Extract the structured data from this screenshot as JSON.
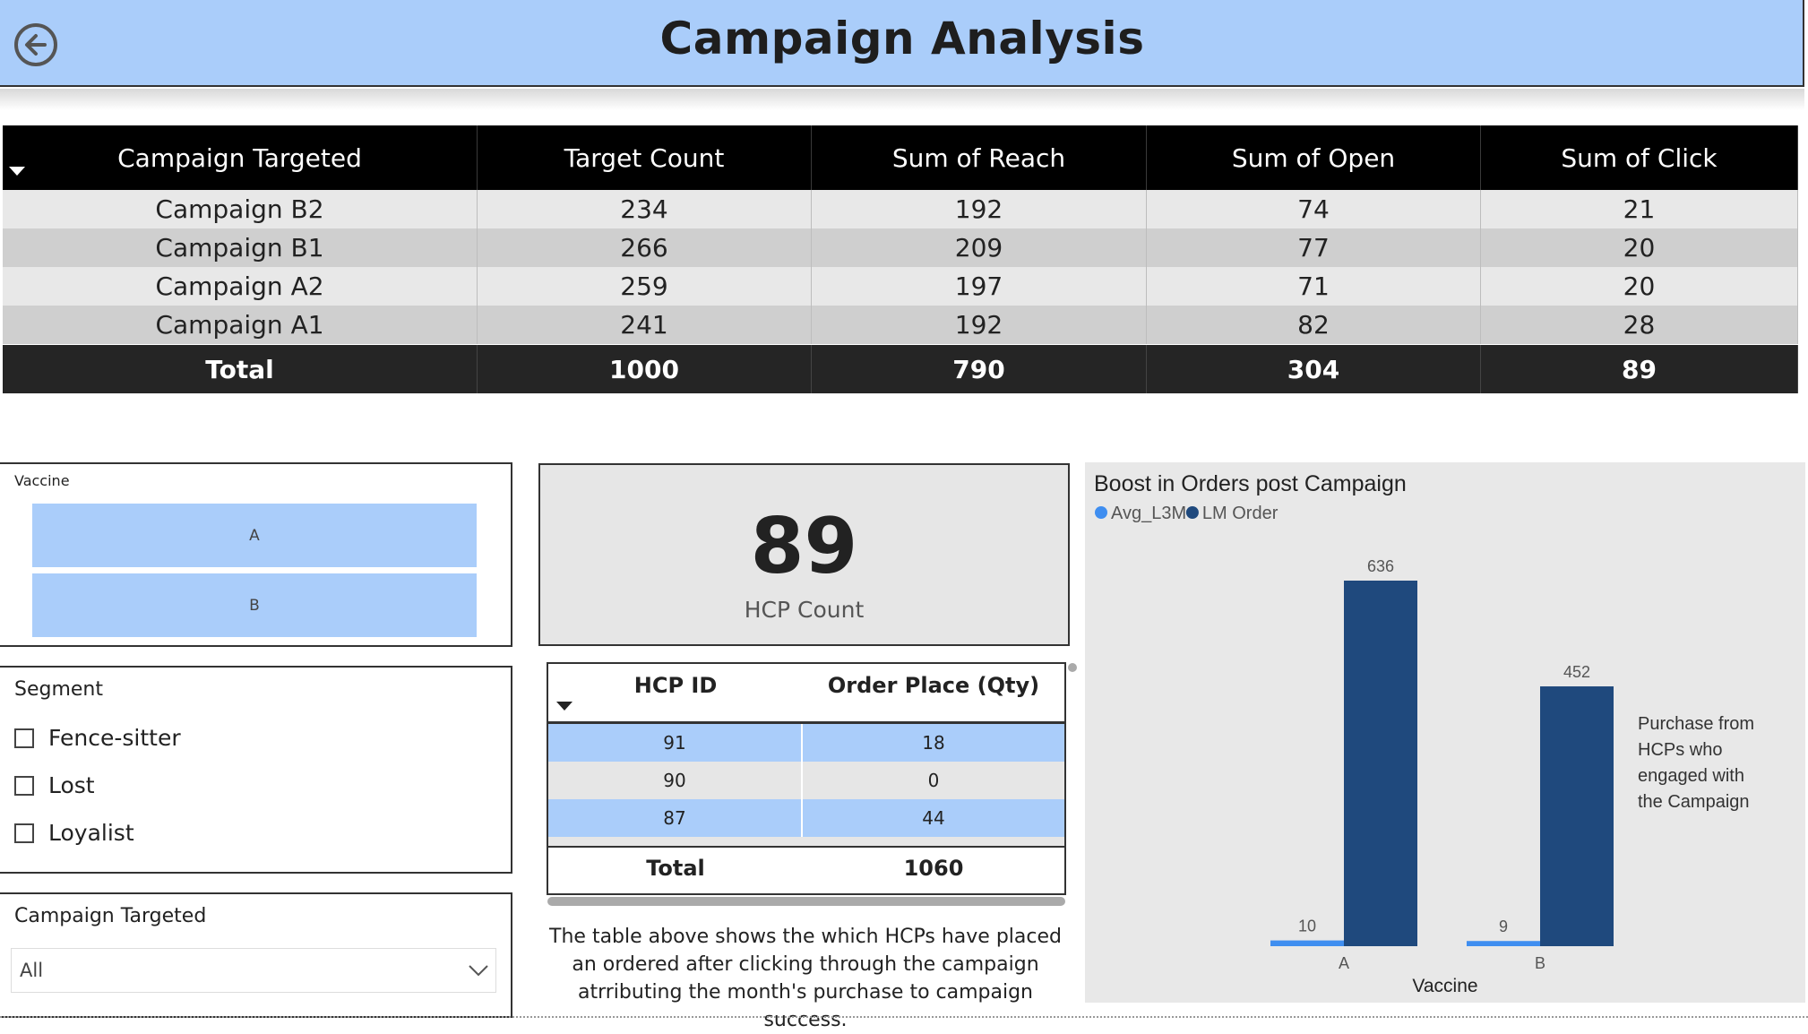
{
  "header": {
    "title": "Campaign Analysis",
    "back_icon": "back-arrow-circle-icon"
  },
  "campaign_table": {
    "columns": [
      "Campaign Targeted",
      "Target Count",
      "Sum of Reach",
      "Sum of Open",
      "Sum of Click"
    ],
    "rows": [
      [
        "Campaign B2",
        "234",
        "192",
        "74",
        "21"
      ],
      [
        "Campaign B1",
        "266",
        "209",
        "77",
        "20"
      ],
      [
        "Campaign A2",
        "259",
        "197",
        "71",
        "20"
      ],
      [
        "Campaign A1",
        "241",
        "192",
        "82",
        "28"
      ]
    ],
    "total": [
      "Total",
      "1000",
      "790",
      "304",
      "89"
    ],
    "row_colors": [
      "#e8e8e8",
      "#cfcfcf"
    ]
  },
  "vaccine_slicer": {
    "title": "Vaccine",
    "options": [
      "A",
      "B"
    ]
  },
  "segment_slicer": {
    "title": "Segment",
    "options": [
      "Fence-sitter",
      "Lost",
      "Loyalist"
    ]
  },
  "campaign_slicer": {
    "title": "Campaign Targeted",
    "selected": "All"
  },
  "card": {
    "value": "89",
    "label": "HCP Count"
  },
  "hcp_table": {
    "columns": [
      "HCP ID",
      "Order Place (Qty)"
    ],
    "rows": [
      [
        "91",
        "18"
      ],
      [
        "90",
        "0"
      ],
      [
        "87",
        "44"
      ]
    ],
    "total": [
      "Total",
      "1060"
    ],
    "row_colors": [
      "#aacdfa",
      "#e6e6e6"
    ]
  },
  "note": "The table above shows the which HCPs have placed an ordered after clicking through the campaign atrributing the month's purchase to campaign success.",
  "chart_data": {
    "type": "bar",
    "title": "Boost in Orders post Campaign",
    "categories": [
      "A",
      "B"
    ],
    "series": [
      {
        "name": "Avg_L3M",
        "values": [
          10,
          9
        ],
        "color": "#3f8ef0"
      },
      {
        "name": "LM Order",
        "values": [
          636,
          452
        ],
        "color": "#1f497d"
      }
    ],
    "xlabel": "Vaccine",
    "ylabel": "",
    "ylim": [
      0,
      636
    ],
    "legend": "top-left",
    "annotation": "Purchase from HCPs who engaged with the Campaign"
  }
}
